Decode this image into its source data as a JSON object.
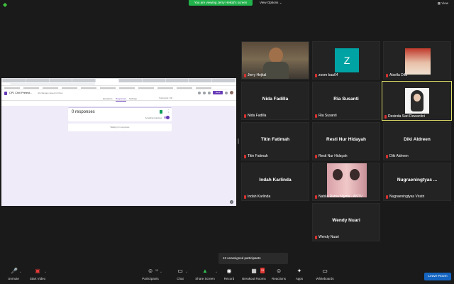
{
  "top": {
    "share_banner": "You are viewing Jerry Heikal's screen",
    "view_options": "View Options",
    "view": "View"
  },
  "shared_screen": {
    "form_title": "CPJ Chril Prelest...",
    "form_saved": "All changes saved in Drive",
    "send_label": "Send",
    "tabs": [
      "Questions",
      "Responses",
      "Settings"
    ],
    "total_points": "Total points: 100",
    "responses_title": "0 responses",
    "accepting_label": "Accepting responses",
    "waiting_text": "Waiting for responses"
  },
  "participants": [
    {
      "name": "Jerry Hejkal",
      "type": "video"
    },
    {
      "name": "zoom baa04",
      "type": "avatar",
      "initial": "Z"
    },
    {
      "name": "Aisella Difa",
      "type": "photo"
    },
    {
      "name": "Nida Fadilla",
      "type": "name",
      "label": "Nida Fadilla"
    },
    {
      "name": "Ria Susanti",
      "type": "name",
      "label": "Ria Susanti"
    },
    {
      "name": "Desinda Sari Dewantini",
      "type": "photo",
      "active": true
    },
    {
      "name": "Titin Fatimah",
      "type": "name",
      "label": "Titin Fatimah"
    },
    {
      "name": "Resti Nur Hidayah",
      "type": "name",
      "label": "Resti Nur Hidayah"
    },
    {
      "name": "Diki Aldreen",
      "type": "name",
      "label": "Diki Aldreen"
    },
    {
      "name": "Indah Karlinda",
      "type": "name",
      "label": "Indah Karlinda"
    },
    {
      "name": "Nabila Ratna Niyma - ANTV",
      "type": "photo"
    },
    {
      "name": "Nugraeningtyas Viratri",
      "type": "name",
      "label": "Nugraeningtyas ..."
    },
    {
      "name": "Wendy Nuari",
      "type": "name",
      "label": "Wendy Nuari"
    }
  ],
  "unassigned": "13 unassigned participants",
  "toolbar": {
    "unmute": "Unmute",
    "start_video": "Start Video",
    "participants": "Participants",
    "participants_count": "13",
    "chat": "Chat",
    "share_screen": "Share Screen",
    "record": "Record",
    "breakout_rooms": "Breakout Rooms",
    "breakout_badge": "13",
    "reactions": "Reactions",
    "apps": "Apps",
    "whiteboards": "Whiteboards",
    "leave": "Leave Room"
  },
  "colors": {
    "banner_green": "#22b24c",
    "active_speaker": "#e0e06a",
    "leave_blue": "#1565c0",
    "form_purple": "#673ab7"
  }
}
